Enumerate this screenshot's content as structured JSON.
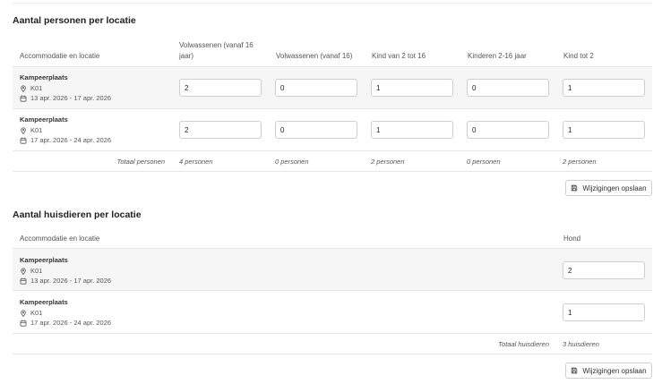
{
  "persons": {
    "title": "Aantal personen per locatie",
    "columns": [
      "Accommodatie en locatie",
      "Volwassenen (vanaf 16 jaar)",
      "Volwassenen (vanaf 16)",
      "Kind van 2 tot 16",
      "Kinderen 2-16 jaar",
      "Kind tot 2"
    ],
    "rows": [
      {
        "name": "Kampeerplaats",
        "location": "K01",
        "dates": "13 apr. 2026 - 17 apr. 2026",
        "values": [
          "2",
          "0",
          "1",
          "0",
          "1"
        ]
      },
      {
        "name": "Kampeerplaats",
        "location": "K01",
        "dates": "17 apr. 2026 - 24 apr. 2026",
        "values": [
          "2",
          "0",
          "1",
          "0",
          "1"
        ]
      }
    ],
    "total_label": "Totaal personen",
    "totals": [
      "4 personen",
      "0 personen",
      "2 personen",
      "0 personen",
      "2 personen"
    ],
    "save_label": "Wijzigingen opslaan"
  },
  "pets": {
    "title": "Aantal huisdieren per locatie",
    "columns": [
      "Accommodatie en locatie",
      "Hond"
    ],
    "rows": [
      {
        "name": "Kampeerplaats",
        "location": "K01",
        "dates": "13 apr. 2026 - 17 apr. 2026",
        "values": [
          "2"
        ]
      },
      {
        "name": "Kampeerplaats",
        "location": "K01",
        "dates": "17 apr. 2026 - 24 apr. 2026",
        "values": [
          "1"
        ]
      }
    ],
    "total_label": "Totaal huisdieren",
    "totals": [
      "3 huisdieren"
    ],
    "save_label": "Wijzigingen opslaan"
  },
  "icons": {
    "location": "map-pin-icon",
    "date": "calendar-icon",
    "save": "floppy-disk-icon"
  }
}
